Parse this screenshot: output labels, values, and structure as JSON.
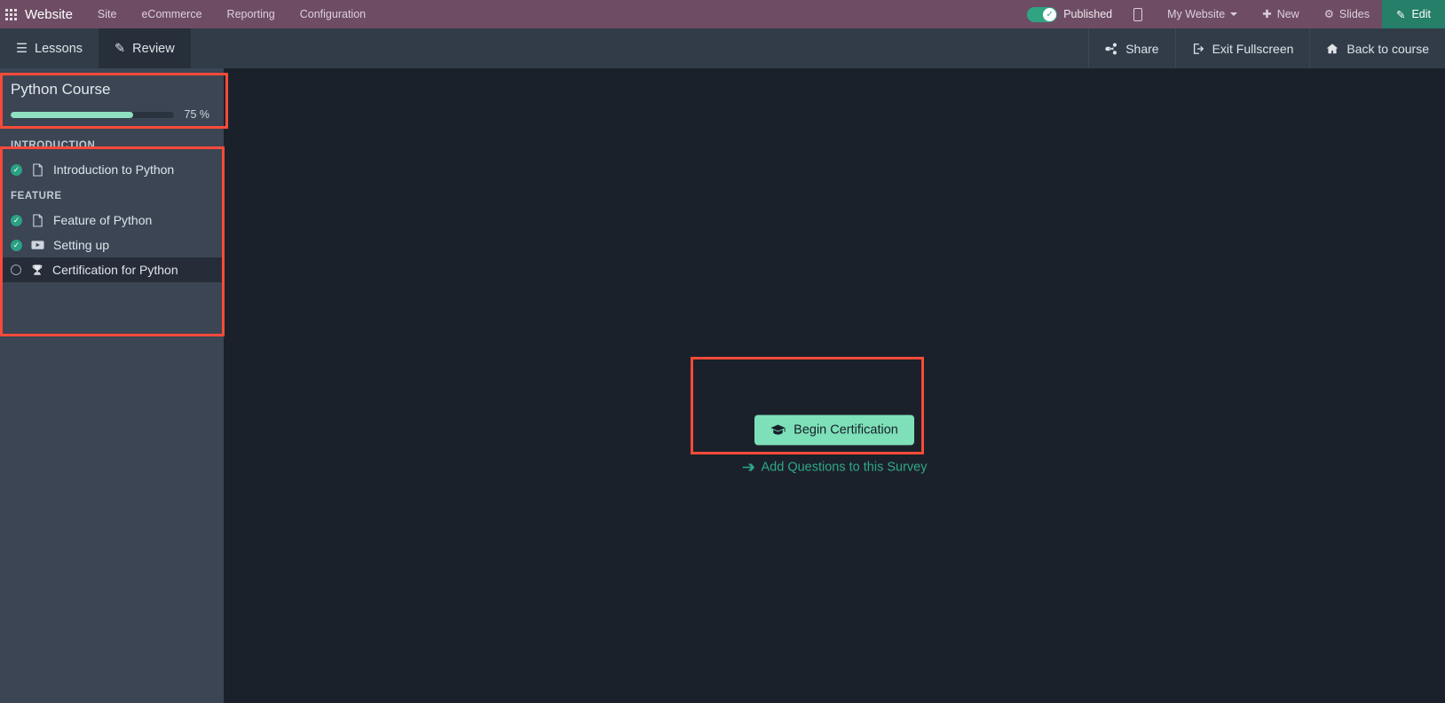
{
  "navbar": {
    "brand": "Website",
    "apps_icon": "apps-grid-icon",
    "menu": [
      {
        "label": "Site"
      },
      {
        "label": "eCommerce"
      },
      {
        "label": "Reporting"
      },
      {
        "label": "Configuration"
      }
    ],
    "published_label": "Published",
    "published_state": "on",
    "mobile_icon": "mobile-preview-icon",
    "website_selector": "My Website",
    "new_label": "New",
    "new_icon": "plus-icon",
    "slides_label": "Slides",
    "slides_icon": "gear-icon",
    "edit_label": "Edit",
    "edit_icon": "pencil-icon"
  },
  "subbar": {
    "tabs": [
      {
        "label": "Lessons",
        "icon": "hamburger-icon",
        "active": false
      },
      {
        "label": "Review",
        "icon": "pencil-icon",
        "active": true
      }
    ],
    "actions": [
      {
        "label": "Share",
        "icon": "share-icon"
      },
      {
        "label": "Exit Fullscreen",
        "icon": "exit-icon"
      },
      {
        "label": "Back to course",
        "icon": "home-icon"
      }
    ]
  },
  "sidebar": {
    "course_title": "Python Course",
    "progress_percent": 75,
    "progress_label": "75 %",
    "sections": [
      {
        "title": "INTRODUCTION",
        "lessons": [
          {
            "label": "Introduction to Python",
            "status": "done",
            "type": "pdf",
            "active": false
          }
        ]
      },
      {
        "title": "FEATURE",
        "lessons": [
          {
            "label": "Feature of Python",
            "status": "done",
            "type": "pdf",
            "active": false
          },
          {
            "label": "Setting up",
            "status": "done",
            "type": "video",
            "active": false
          },
          {
            "label": "Certification for Python",
            "status": "todo",
            "type": "certification",
            "active": true
          }
        ]
      }
    ]
  },
  "main": {
    "begin_button_label": "Begin Certification",
    "begin_button_icon": "graduation-cap-icon",
    "survey_link_label": "Add Questions to this Survey",
    "survey_link_icon": "arrow-right-icon"
  },
  "colors": {
    "navbar": "#6e4d64",
    "subbar": "#323c49",
    "sidebar": "#3b4554",
    "canvas": "#1b212a",
    "accent_green": "#7ee0b8",
    "accent_teal": "#2fa886",
    "annotation_red": "#fc4a3a"
  },
  "annotations": [
    {
      "name": "course-header-highlight"
    },
    {
      "name": "lesson-list-highlight"
    },
    {
      "name": "certification-actions-highlight"
    }
  ]
}
